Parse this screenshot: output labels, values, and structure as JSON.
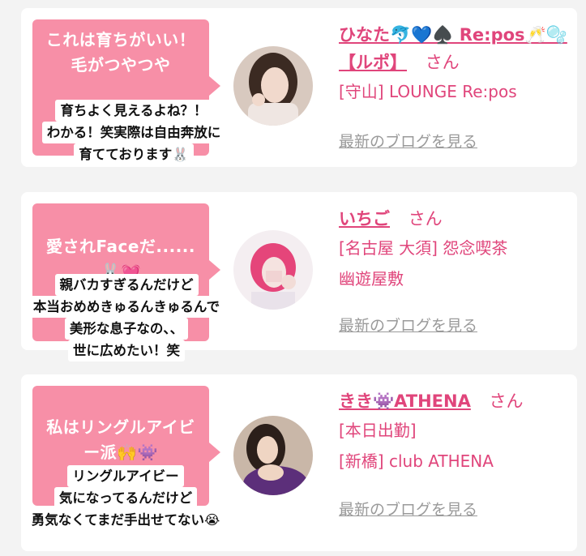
{
  "cards": [
    {
      "bubble_title": "これは育ちがいい！毛がつやつや",
      "comment_lines": [
        "育ちよく見えるよね？！",
        "わかる！笑実際は自由奔放に",
        "育てております🐰"
      ],
      "name": "ひなた🐬💙♠️ Re:pos🥂🫧【ルポ】",
      "suffix": "さん",
      "shop_lines": [
        "[守山] LOUNGE Re:pos"
      ],
      "blog_link": "最新のブログを見る",
      "avatar": "woman-with-dark-hair-photo"
    },
    {
      "bubble_title": "愛されFaceだ......🐰💓",
      "comment_lines": [
        "親バカすぎるんだけど",
        "本当おめめきゅるんきゅるんで",
        "美形な息子なの、、",
        "世に広めたい！笑"
      ],
      "name": "いちご",
      "suffix": "さん",
      "shop_lines": [
        "[名古屋 大須] 怨念喫茶",
        "幽遊屋敷"
      ],
      "blog_link": "最新のブログを見る",
      "avatar": "pink-hair-portrait"
    },
    {
      "bubble_title": "私はリングルアイビー派🙌👾",
      "comment_lines": [
        "リングルアイビー",
        "気になってるんだけど",
        "勇気なくてまだ手出せてない😭"
      ],
      "name": "きき👾ATHENA",
      "suffix": "さん",
      "shop_lines": [
        "[本日出勤]",
        "[新橋] club ATHENA"
      ],
      "blog_link": "最新のブログを見る",
      "avatar": "woman-purple-dress-photo"
    }
  ],
  "colors": {
    "accent": "#e0457b",
    "bubble": "#f78fa7",
    "muted": "#9a9a9a",
    "background": "#f3f3f3"
  }
}
